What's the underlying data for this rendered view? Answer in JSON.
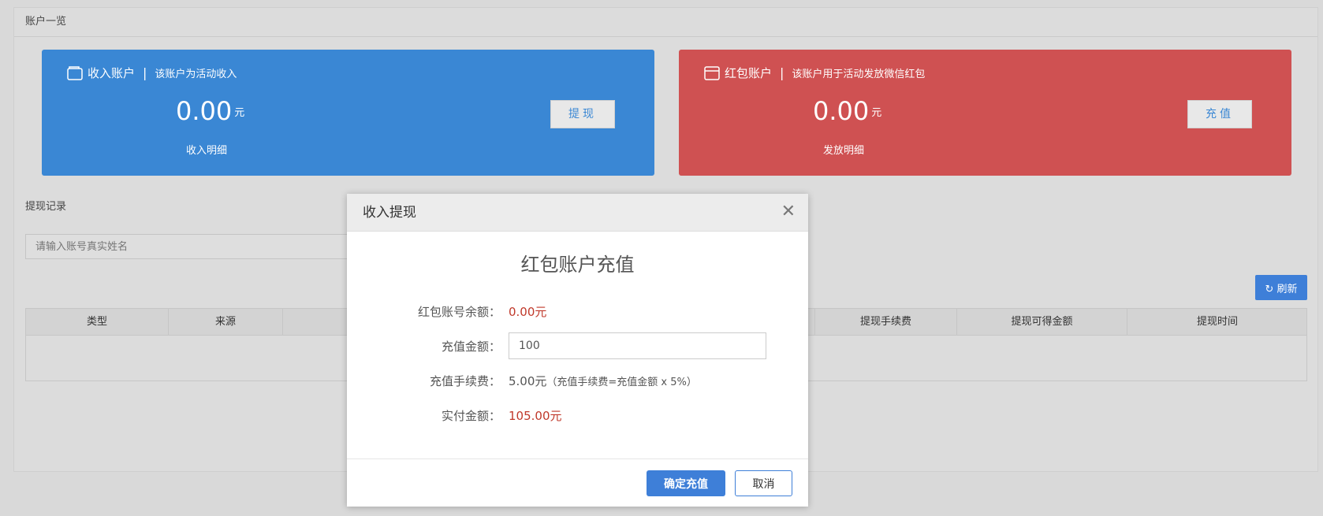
{
  "panel": {
    "title": "账户一览"
  },
  "income": {
    "title": "收入账户",
    "sep": "|",
    "desc": "该账户为活动收入",
    "amount": "0.00",
    "unit": "元",
    "detail": "收入明细",
    "button": "提现",
    "icon": "wallet-icon",
    "color": "#3a87d4"
  },
  "redpacket": {
    "title": "红包账户",
    "sep": "|",
    "desc": "该账户用于活动发放微信红包",
    "amount": "0.00",
    "unit": "元",
    "detail": "发放明细",
    "button": "充值",
    "icon": "envelope-icon",
    "color": "#cf5152"
  },
  "records": {
    "label": "提现记录",
    "search_placeholder": "请输入账号真实姓名",
    "refresh": "刷新",
    "columns": [
      "类型",
      "来源",
      "提现手续费",
      "提现可得金额",
      "提现时间"
    ]
  },
  "modal": {
    "header": "收入提现",
    "title": "红包账户充值",
    "balance_label": "红包账号余额：",
    "balance_value": "0.00元",
    "amount_label": "充值金额：",
    "amount_value": "100",
    "fee_label": "充值手续费：",
    "fee_value": "5.00元",
    "fee_note": "（充值手续费=充值金额 x 5%）",
    "pay_label": "实付金额：",
    "pay_value": "105.00元",
    "confirm": "确定充值",
    "cancel": "取消"
  }
}
